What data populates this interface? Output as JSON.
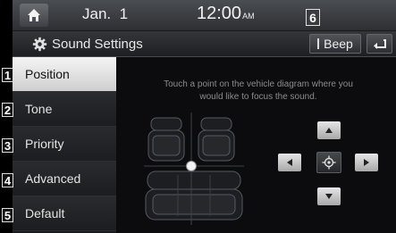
{
  "status_bar": {
    "date": "Jan.  1",
    "time": "12:00",
    "ampm": "AM"
  },
  "title_bar": {
    "title": "Sound Settings",
    "beep_label": "Beep",
    "callout_number": "6"
  },
  "sidebar": {
    "items": [
      {
        "number": "1",
        "label": "Position",
        "active": true
      },
      {
        "number": "2",
        "label": "Tone",
        "active": false
      },
      {
        "number": "3",
        "label": "Priority",
        "active": false
      },
      {
        "number": "4",
        "label": "Advanced",
        "active": false
      },
      {
        "number": "5",
        "label": "Default",
        "active": false
      }
    ]
  },
  "content": {
    "hint_line1": "Touch a point on the vehicle diagram where you",
    "hint_line2": "would like to focus the sound."
  },
  "icons": [
    "home-icon",
    "gear-icon",
    "back-icon",
    "up-arrow-icon",
    "left-arrow-icon",
    "right-arrow-icon",
    "down-arrow-icon",
    "center-target-icon"
  ],
  "colors": {
    "active_tab_bg": "#e6e6e6",
    "inactive_tab_bg": "#222326",
    "screen_bg": "#0b0b0d",
    "hint_text": "#8c8c8c"
  }
}
